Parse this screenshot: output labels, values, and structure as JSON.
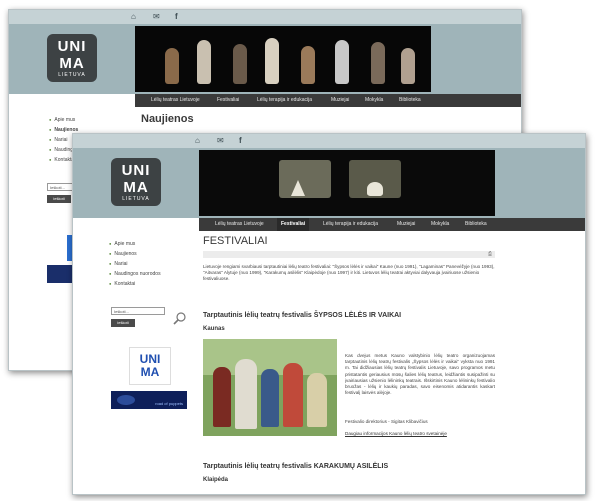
{
  "top_icons": [
    "home-icon",
    "mail-icon",
    "facebook-icon"
  ],
  "logo": {
    "line1": "UNI",
    "line2": "MA",
    "sub": "LIETUVA"
  },
  "nav_back": [
    "Lėlių teatras Lietuvoje",
    "Festivaliai",
    "Lėlių terapija ir edukacija",
    "Muziejai",
    "Mokykla",
    "Biblioteka"
  ],
  "nav_front": [
    "Lėlių teatras Lietuvoje",
    "Festivaliai",
    "Lėlių terapija ir edukacija",
    "Muziejai",
    "Mokykla",
    "Biblioteka"
  ],
  "nav_front_active": "Festivaliai",
  "back": {
    "title": "Naujienos",
    "menu": [
      "Apie mus",
      "Naujienos",
      "Nariai",
      "Naudingos",
      "Kontaktai"
    ],
    "search_placeholder": "Ieškoti...",
    "search_button": "ieškoti"
  },
  "front": {
    "menu": [
      "Apie mus",
      "Naujienos",
      "Nariai",
      "Naudingos nuorodos",
      "Kontaktai"
    ],
    "search_placeholder": "Ieškoti...",
    "search_button": "ieškoti",
    "banner2_text": "road of puppets",
    "title": "FESTIVALIAI",
    "intro": "Lietuvoje rengiami svarbiausi tarptautiniai lėlių teatro festivaliai: \"Šypsos lėlės ir vaikai\" Kaune (nuo 1991), \"Lagaminas\" Panevėžyje (nuo 1993), \"Aitvaras\" Alytuje (nuo 1999), \"Karakumų asilėlis\" Klaipėdoje (nuo 1997) ir kiti. Lietuvos lėlių teatrai aktyviai dalyvauja įvairiuose užsienio festivaliuose.",
    "fest1_title": "Tarptautinis lėlių teatrų festivalis ŠYPSOS LĖLĖS IR VAIKAI",
    "fest1_city": "Kaunas",
    "fest1_text": "Kas dvejus metus Kauno valstybinio lėlių teatro organizuojamas tarptautinis lėlių teatrų festivalis „Šypsos lėlės ir vaikai“ vyksta nuo 1991 m. Tai didžiausias lėlių teatrų festivalis Lietuvoje, savo programos metu pristatantis geriausius mūsų šalies lėlių teatrus, leidžiantis susipažinti su įvairiausias užsienio lėlininkų teatrais. Išskirtinis Kauno lėlininkų festivalio bruožas - lėlių ir kaukių paradas, savo eisenomis atidarantis kaskart festivalį laisvės alėjoje.",
    "fest1_director": "Festivalio direktorius - Sigitas Klibavičius",
    "fest1_link": "Daugiau informacijos Kauno lėlių teatro svetainėje",
    "fest2_title": "Tarptautinis lėlių teatrų festivalis KARAKUMŲ ASILĖLIS",
    "fest2_city": "Klaipėda"
  }
}
